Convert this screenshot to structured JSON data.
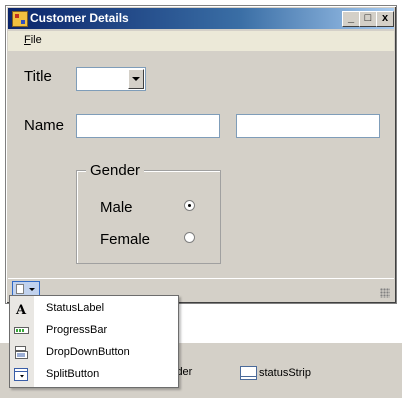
{
  "window": {
    "title": "Customer Details",
    "controls": {
      "minimize": "_",
      "maximize": "□",
      "close": "x"
    }
  },
  "menu": {
    "file_label": "ile",
    "file_mnemonic": "F"
  },
  "form": {
    "title_label": "Title",
    "title_combo_value": "",
    "name_label": "Name",
    "first_name_value": "",
    "last_name_value": "",
    "gender_group_title": "Gender",
    "gender_options": [
      {
        "label": "Male",
        "checked": true
      },
      {
        "label": "Female",
        "checked": false
      }
    ]
  },
  "status_dropdown": {
    "items": [
      {
        "label": "StatusLabel",
        "icon": "text-label-icon"
      },
      {
        "label": "ProgressBar",
        "icon": "progress-bar-icon"
      },
      {
        "label": "DropDownButton",
        "icon": "dropdown-button-icon"
      },
      {
        "label": "SplitButton",
        "icon": "split-button-icon"
      }
    ]
  },
  "component_tray": {
    "items": [
      {
        "label": "ider",
        "icon": "component-icon"
      },
      {
        "label": "statusStrip",
        "icon": "status-strip-icon"
      }
    ]
  },
  "colors": {
    "titlebar_start": "#0a246a",
    "titlebar_end": "#a6caf0",
    "form_background": "#d4d0c8",
    "selection_highlight": "#316ac5"
  }
}
